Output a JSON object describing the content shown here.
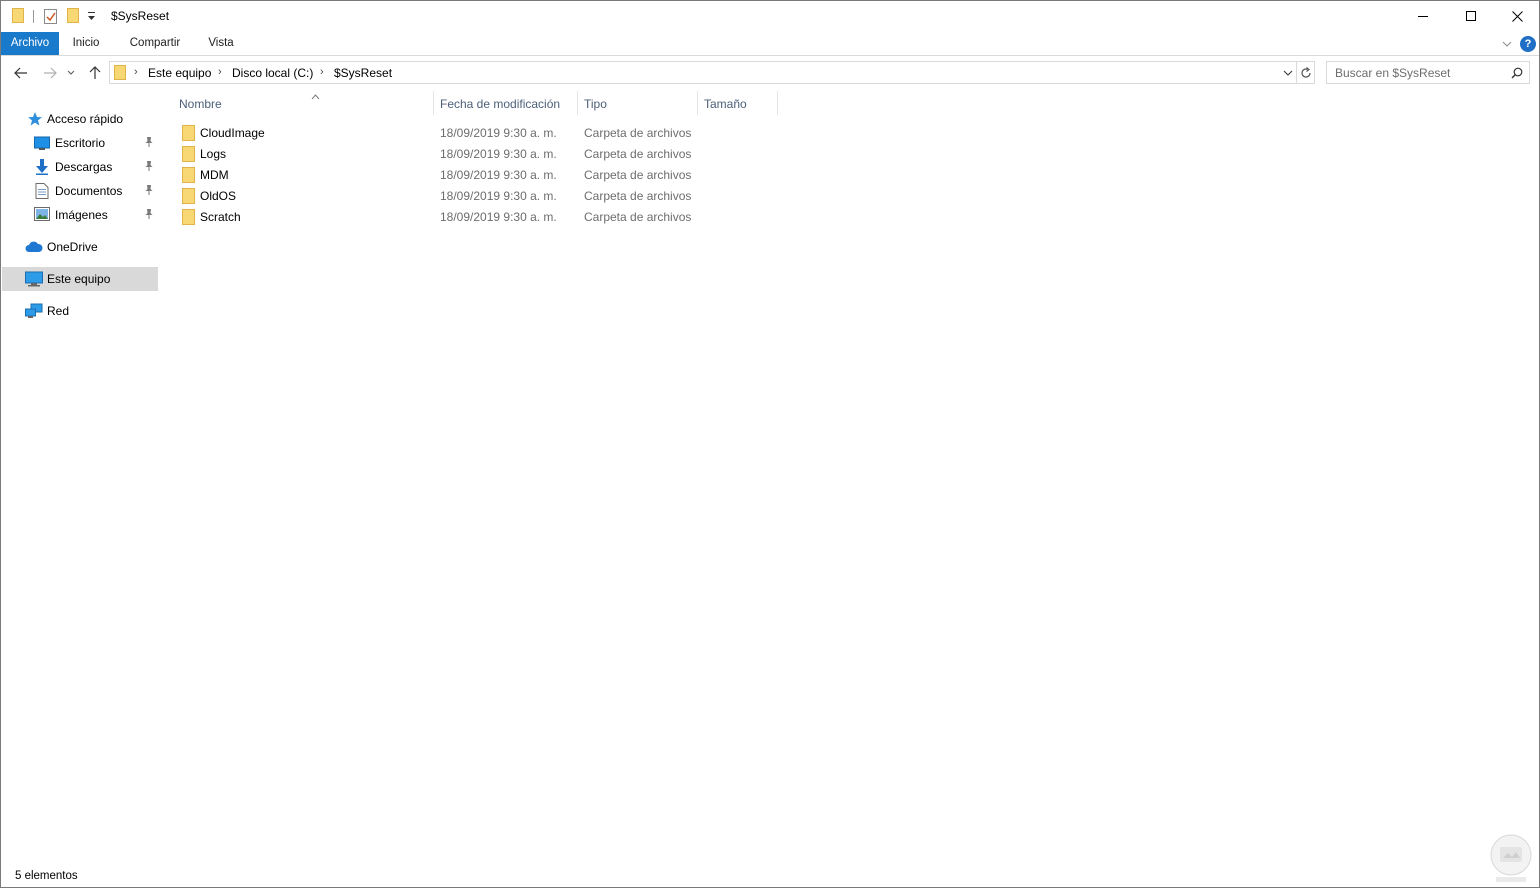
{
  "window": {
    "title": "$SysReset"
  },
  "titlebar": {
    "quick_access_icons": [
      "folder-icon",
      "properties-check-icon",
      "new-folder-icon",
      "customize-dropdown-icon"
    ],
    "controls": [
      "minimize-icon",
      "maximize-icon",
      "close-icon"
    ]
  },
  "ribbon": {
    "tabs": [
      {
        "label": "Archivo",
        "active": true
      },
      {
        "label": "Inicio"
      },
      {
        "label": "Compartir"
      },
      {
        "label": "Vista"
      }
    ],
    "help_label": "?"
  },
  "address": {
    "breadcrumbs": [
      "Este equipo",
      "Disco local (C:)",
      "$SysReset"
    ],
    "separator": "›"
  },
  "search": {
    "placeholder": "Buscar en $SysReset"
  },
  "navpane": {
    "quick_access": {
      "label": "Acceso rápido",
      "icon": "star-icon"
    },
    "pinned": [
      {
        "label": "Escritorio",
        "icon": "desktop-icon"
      },
      {
        "label": "Descargas",
        "icon": "download-arrow-icon"
      },
      {
        "label": "Documentos",
        "icon": "document-icon"
      },
      {
        "label": "Imágenes",
        "icon": "pictures-icon"
      }
    ],
    "onedrive": {
      "label": "OneDrive",
      "icon": "cloud-icon"
    },
    "this_pc": {
      "label": "Este equipo",
      "icon": "computer-icon",
      "selected": true
    },
    "network": {
      "label": "Red",
      "icon": "network-icon"
    }
  },
  "columns": {
    "name": "Nombre",
    "modified": "Fecha de modificación",
    "type": "Tipo",
    "size": "Tamaño"
  },
  "files": [
    {
      "name": "CloudImage",
      "modified": "18/09/2019 9:30 a. m.",
      "type": "Carpeta de archivos"
    },
    {
      "name": "Logs",
      "modified": "18/09/2019 9:30 a. m.",
      "type": "Carpeta de archivos"
    },
    {
      "name": "MDM",
      "modified": "18/09/2019 9:30 a. m.",
      "type": "Carpeta de archivos"
    },
    {
      "name": "OldOS",
      "modified": "18/09/2019 9:30 a. m.",
      "type": "Carpeta de archivos"
    },
    {
      "name": "Scratch",
      "modified": "18/09/2019 9:30 a. m.",
      "type": "Carpeta de archivos"
    }
  ],
  "status": {
    "item_count": "5 elementos"
  },
  "colors": {
    "ribbon_active": "#1979ca",
    "folder_yellow": "#f8d775",
    "selection": "#d9d9d9",
    "header_text": "#4c607a"
  }
}
